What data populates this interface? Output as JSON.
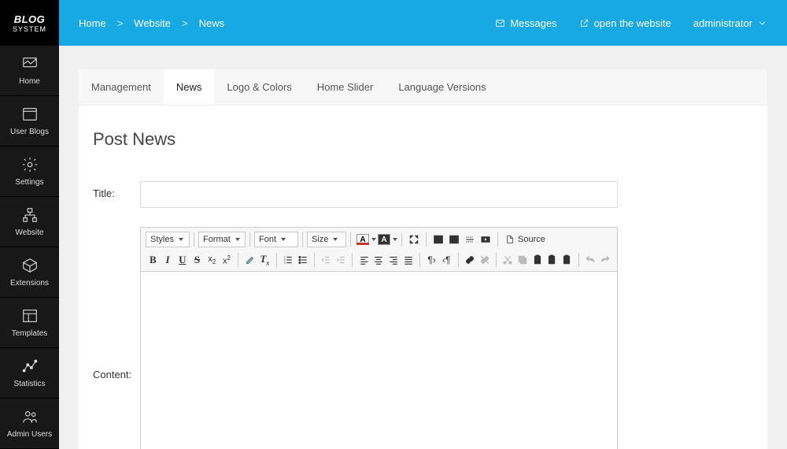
{
  "brand": {
    "line1": "BLOG",
    "line2": "SYSTEM"
  },
  "sidebar": [
    {
      "label": "Home"
    },
    {
      "label": "User Blogs"
    },
    {
      "label": "Settings"
    },
    {
      "label": "Website"
    },
    {
      "label": "Extensions"
    },
    {
      "label": "Templates"
    },
    {
      "label": "Statistics"
    },
    {
      "label": "Admin Users"
    }
  ],
  "breadcrumb": [
    "Home",
    "Website",
    "News"
  ],
  "top": {
    "messages": "Messages",
    "open_site": "open the website",
    "user": "administrator"
  },
  "tabs": [
    "Management",
    "News",
    "Logo & Colors",
    "Home Slider",
    "Language Versions"
  ],
  "active_tab": "News",
  "page_title": "Post News",
  "form": {
    "title_label": "Title:",
    "title_value": "",
    "content_label": "Content:"
  },
  "editor_combos": {
    "styles": "Styles",
    "format": "Format",
    "font": "Font",
    "size": "Size"
  },
  "editor_source": "Source"
}
